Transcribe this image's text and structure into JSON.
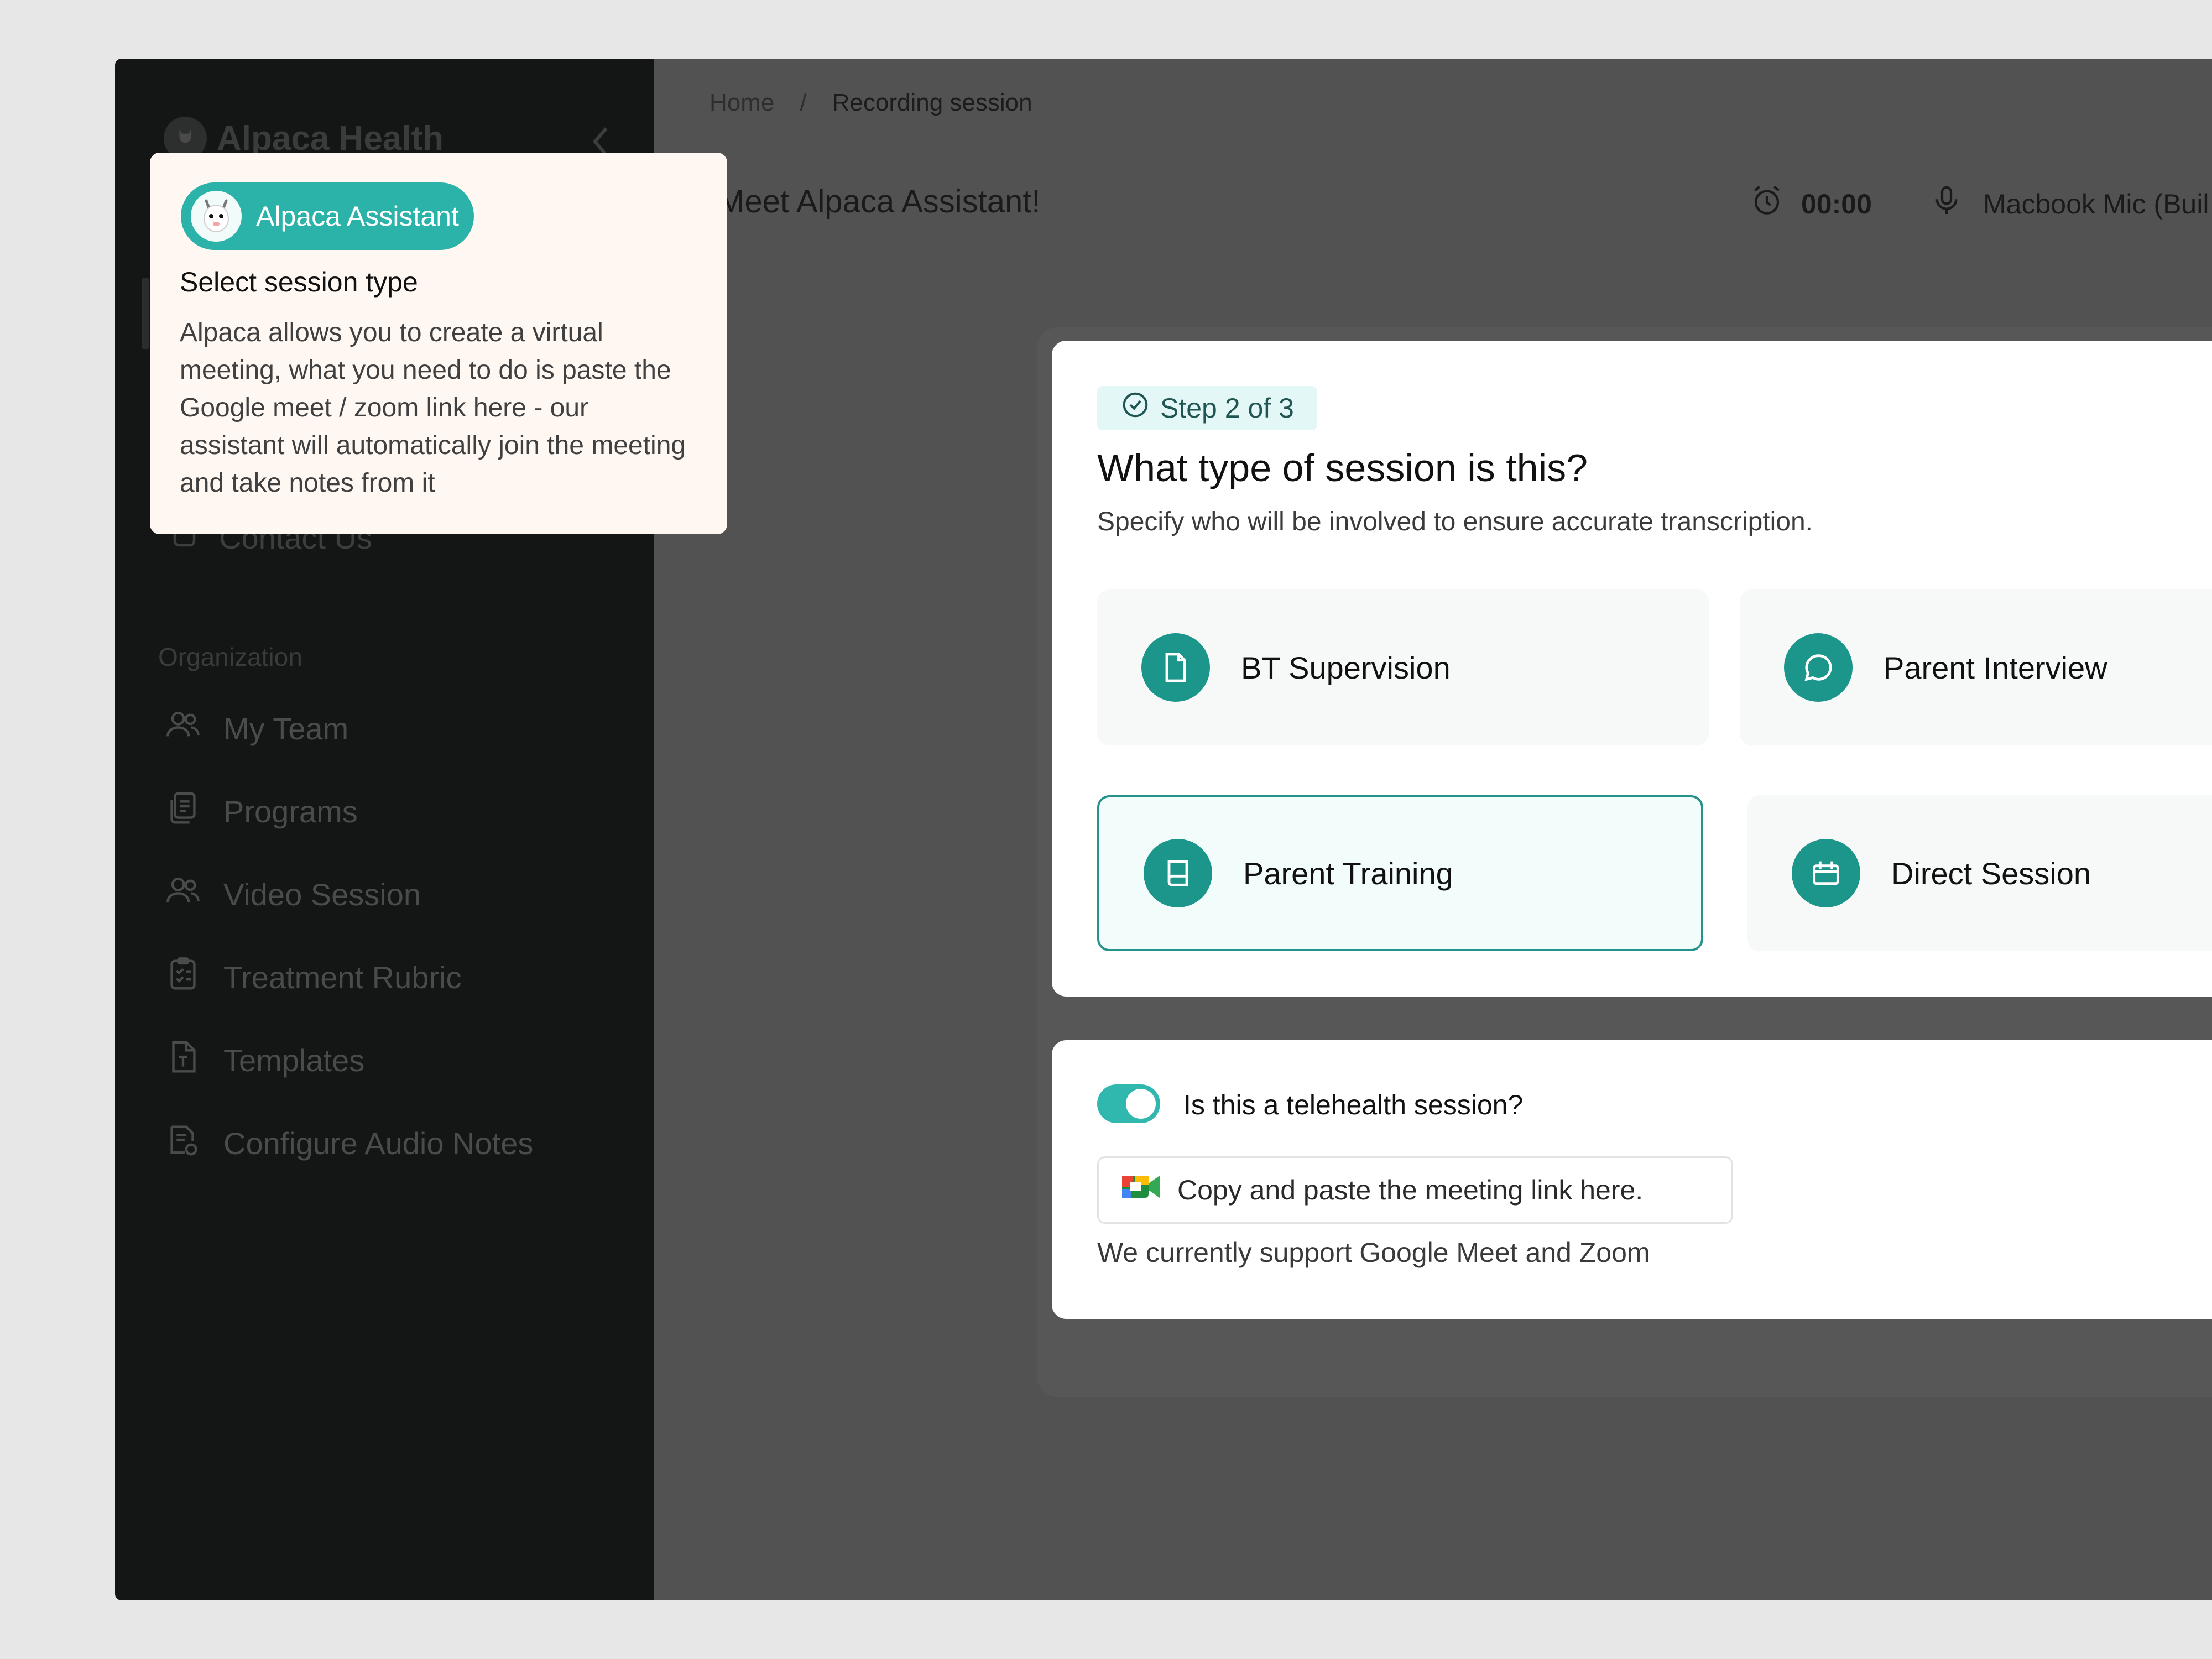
{
  "sidebar": {
    "brand": "Alpaca Health",
    "contact_label": "Contact Us",
    "section_label": "Organization",
    "items": [
      {
        "label": "My Team",
        "icon": "users-icon"
      },
      {
        "label": "Programs",
        "icon": "copy-document-icon"
      },
      {
        "label": "Video Session",
        "icon": "users-icon"
      },
      {
        "label": "Treatment Rubric",
        "icon": "clipboard-check-icon"
      },
      {
        "label": "Templates",
        "icon": "template-file-icon"
      },
      {
        "label": "Configure Audio Notes",
        "icon": "audio-notes-icon"
      }
    ]
  },
  "header": {
    "breadcrumb": {
      "home": "Home",
      "separator": "/",
      "current": "Recording session"
    },
    "title": "Meet Alpaca Assistant!",
    "timer": "00:00",
    "mic_label": "Macbook Mic (Buil"
  },
  "session_card": {
    "step": "Step 2 of 3",
    "question": "What type of session is this?",
    "subtitle": "Specify who will be involved to ensure accurate transcription.",
    "options": [
      {
        "label": "BT Supervision",
        "icon": "document-icon",
        "selected": false
      },
      {
        "label": "Parent Interview",
        "icon": "chat-bubble-icon",
        "selected": false
      },
      {
        "label": "Parent Training",
        "icon": "book-icon",
        "selected": true
      },
      {
        "label": "Direct Session",
        "icon": "calendar-icon",
        "selected": false
      }
    ]
  },
  "telehealth": {
    "label": "Is this a telehealth session?",
    "enabled": true,
    "placeholder": "Copy and paste the meeting link here.",
    "note": "We currently support Google Meet and Zoom"
  },
  "tooltip": {
    "badge": "Alpaca Assistant",
    "title": "Select session type",
    "body": "Alpaca allows you to create a virtual meeting, what you need to do is paste the Google meet / zoom link here - our assistant will automatically join the meeting and take notes from it"
  },
  "colors": {
    "accent": "#1c968b",
    "toggle": "#31b8ae",
    "sidebar": "#141515",
    "overlay": "#525252",
    "tooltip_bg": "#fff7f2"
  }
}
